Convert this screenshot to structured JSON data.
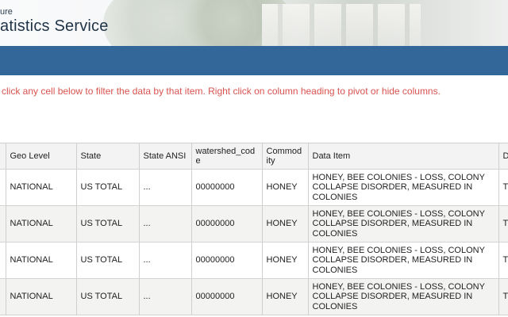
{
  "header": {
    "subtitle_fragment": "ure",
    "title_fragment": "atistics Service"
  },
  "instruction": "click any cell below to filter the data by that item. Right click on column heading to pivot or hide columns.",
  "table": {
    "columns": [
      "",
      "Geo Level",
      "State",
      "State ANSI",
      "watershed_cod\ne",
      "Commod\nity",
      "Data Item",
      "D"
    ],
    "rows": [
      {
        "geo_level": "NATIONAL",
        "state": "US TOTAL",
        "state_ansi": "...",
        "watershed_code": "00000000",
        "commodity": "HONEY",
        "data_item": "HONEY, BEE COLONIES - LOSS, COLONY COLLAPSE DISORDER, MEASURED IN COLONIES",
        "next_col": "T"
      },
      {
        "geo_level": "NATIONAL",
        "state": "US TOTAL",
        "state_ansi": "...",
        "watershed_code": "00000000",
        "commodity": "HONEY",
        "data_item": "HONEY, BEE COLONIES - LOSS, COLONY COLLAPSE DISORDER, MEASURED IN COLONIES",
        "next_col": "T"
      },
      {
        "geo_level": "NATIONAL",
        "state": "US TOTAL",
        "state_ansi": "...",
        "watershed_code": "00000000",
        "commodity": "HONEY",
        "data_item": "HONEY, BEE COLONIES - LOSS, COLONY COLLAPSE DISORDER, MEASURED IN COLONIES",
        "next_col": "T"
      },
      {
        "geo_level": "NATIONAL",
        "state": "US TOTAL",
        "state_ansi": "...",
        "watershed_code": "00000000",
        "commodity": "HONEY",
        "data_item": "HONEY, BEE COLONIES - LOSS, COLONY COLLAPSE DISORDER, MEASURED IN COLONIES",
        "next_col": "T"
      }
    ]
  },
  "colors": {
    "nav_bar": "#336699",
    "instruction_text": "#d9534f",
    "header_bg": "#f3f3f3",
    "alt_row_bg": "#f3f3f1"
  }
}
